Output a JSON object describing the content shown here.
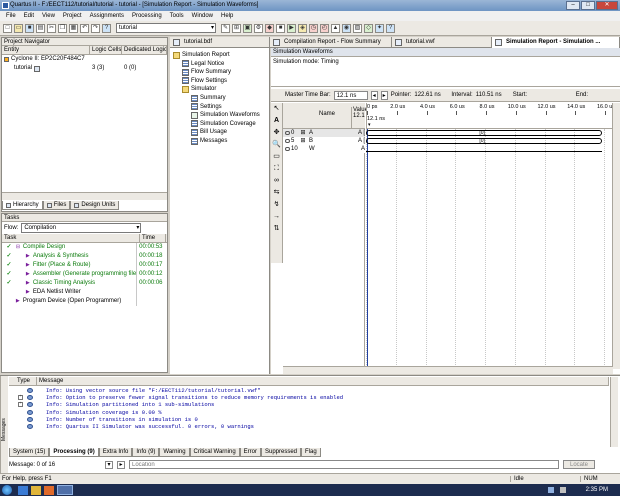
{
  "window": {
    "title": "Quartus II - F:/EECT112/tutorial/tutorial - tutorial - [Simulation Report - Simulation Waveforms]"
  },
  "menu": [
    "File",
    "Edit",
    "View",
    "Project",
    "Assignments",
    "Processing",
    "Tools",
    "Window",
    "Help"
  ],
  "toolbar": {
    "entity": "tutorial"
  },
  "project_navigator": {
    "title": "Project Navigator",
    "columns": [
      "Entity",
      "Logic Cells",
      "Dedicated Logic"
    ],
    "device": "Cyclone II: EP2C20F484C7",
    "entity": "tutorial",
    "logic_cells": "3 (3)",
    "dedicated": "0 (0)",
    "tabs": [
      "Hierarchy",
      "Files",
      "Design Units"
    ]
  },
  "tasks": {
    "title": "Tasks",
    "flow_label": "Flow:",
    "flow_value": "Compilation",
    "columns": [
      "Task",
      "Time"
    ],
    "items": [
      {
        "name": "Compile Design",
        "time": "00:00:53",
        "check": true,
        "level": 0
      },
      {
        "name": "Analysis & Synthesis",
        "time": "00:00:18",
        "check": true,
        "level": 1
      },
      {
        "name": "Fitter (Place & Route)",
        "time": "00:00:17",
        "check": true,
        "level": 1
      },
      {
        "name": "Assembler (Generate programming files)",
        "time": "00:00:12",
        "check": true,
        "level": 1
      },
      {
        "name": "Classic Timing Analysis",
        "time": "00:00:06",
        "check": true,
        "level": 1
      },
      {
        "name": "EDA Netlist Writer",
        "time": "",
        "check": false,
        "level": 1
      },
      {
        "name": "Program Device (Open Programmer)",
        "time": "",
        "check": false,
        "level": 0
      }
    ]
  },
  "doc_tabs": [
    "tutorial.bdf",
    "Compilation Report - Flow Summary",
    "tutorial.vwf",
    "Simulation Report - Simulation ..."
  ],
  "report_tree": [
    {
      "label": "Simulation Report",
      "level": 0,
      "icon": "folder"
    },
    {
      "label": "Legal Notice",
      "level": 1,
      "icon": "table"
    },
    {
      "label": "Flow Summary",
      "level": 1,
      "icon": "table"
    },
    {
      "label": "Flow Settings",
      "level": 1,
      "icon": "table"
    },
    {
      "label": "Simulator",
      "level": 1,
      "icon": "folder"
    },
    {
      "label": "Summary",
      "level": 2,
      "icon": "table"
    },
    {
      "label": "Settings",
      "level": 2,
      "icon": "table"
    },
    {
      "label": "Simulation Waveforms",
      "level": 2,
      "icon": "wave"
    },
    {
      "label": "Simulation Coverage",
      "level": 2,
      "icon": "table"
    },
    {
      "label": "Bill Usage",
      "level": 2,
      "icon": "table"
    },
    {
      "label": "Messages",
      "level": 2,
      "icon": "table"
    }
  ],
  "waveform": {
    "header": "Simulation Waveforms",
    "mode": "Simulation mode: Timing",
    "master_time_label": "Master Time Bar:",
    "master_time": "12.1 ns",
    "pointer_label": "Pointer:",
    "pointer": "122.61 ns",
    "interval_label": "Interval:",
    "interval": "110.51 ns",
    "start_label": "Start:",
    "end_label": "End:",
    "name_col": "Name",
    "value_col": "Value",
    "value_sub": "12.1",
    "time_ticks": [
      "0 ps",
      "2.0 us",
      "4.0 us",
      "6.0 us",
      "8.0 us",
      "10.0 us",
      "12.0 us",
      "14.0 us",
      "16.0 us"
    ],
    "cursor_label": "12.1 ns",
    "signals": [
      {
        "idx": "0",
        "name": "A",
        "value": "A [",
        "wave": "[0]"
      },
      {
        "idx": "5",
        "name": "B",
        "value": "A [",
        "wave": "[0]"
      },
      {
        "idx": "10",
        "name": "W",
        "value": "A",
        "wave": ""
      }
    ]
  },
  "messages": {
    "columns": [
      "Type",
      "Message"
    ],
    "lines": [
      "Info: Using vector source file \"F:/EECT112/tutorial/tutorial.vwf\"",
      "Info: Option to preserve fewer signal transitions to reduce memory requirements is enabled",
      "Info: Simulation partitioned into 1 sub-simulations",
      "Info: Simulation coverage is       0.00 %",
      "Info: Number of transitions in simulation is 0",
      "Info: Quartus II Simulator was successful. 0 errors, 0 warnings"
    ],
    "tabs": [
      "System (15)",
      "Processing (9)",
      "Extra Info",
      "Info (9)",
      "Warning",
      "Critical Warning",
      "Error",
      "Suppressed",
      "Flag"
    ],
    "count": "Message: 0 of 16",
    "location_placeholder": "Location",
    "locate_button": "Locate",
    "side_label": "Messages"
  },
  "status": {
    "help": "For Help, press F1",
    "idle": "Idle",
    "num": "NUM"
  },
  "taskbar": {
    "time": "2:35 PM"
  }
}
